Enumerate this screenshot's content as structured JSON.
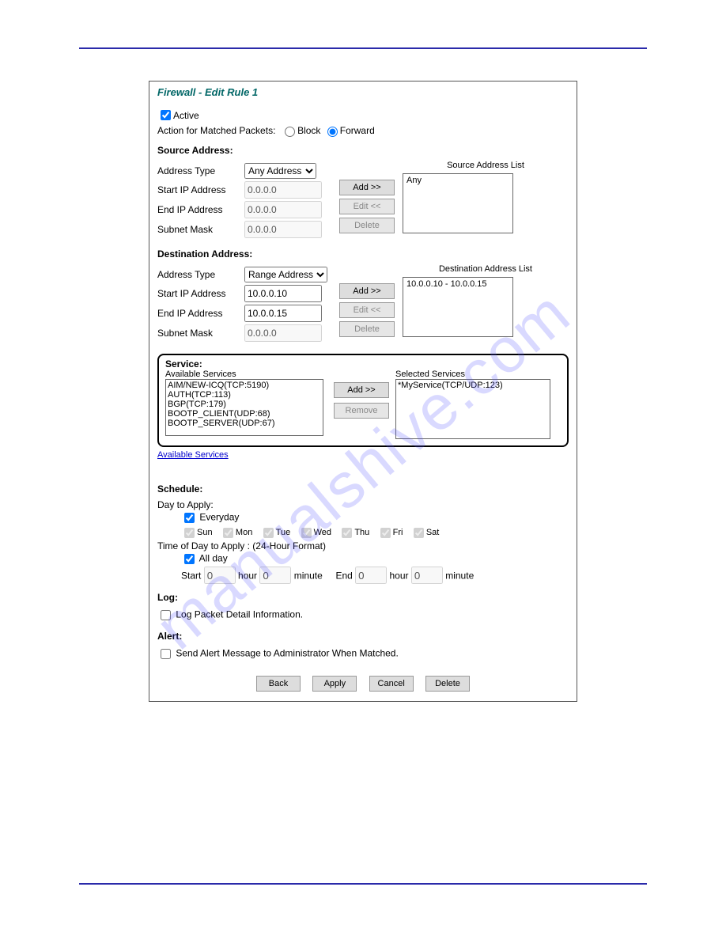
{
  "watermark": "manualshive.com",
  "panel_title": "Firewall - Edit Rule 1",
  "active_label": "Active",
  "active_checked": true,
  "action_label": "Action for Matched Packets:",
  "action_block": "Block",
  "action_forward": "Forward",
  "action_selected": "Forward",
  "source": {
    "heading": "Source Address:",
    "list_label": "Source Address List",
    "address_type_label": "Address Type",
    "address_type_value": "Any Address",
    "start_ip_label": "Start IP Address",
    "start_ip_value": "0.0.0.0",
    "end_ip_label": "End IP Address",
    "end_ip_value": "0.0.0.0",
    "subnet_label": "Subnet Mask",
    "subnet_value": "0.0.0.0",
    "add_btn": "Add >>",
    "edit_btn": "Edit <<",
    "delete_btn": "Delete",
    "list_items": [
      "Any"
    ]
  },
  "dest": {
    "heading": "Destination Address:",
    "list_label": "Destination Address List",
    "address_type_label": "Address Type",
    "address_type_value": "Range Address",
    "start_ip_label": "Start IP Address",
    "start_ip_value": "10.0.0.10",
    "end_ip_label": "End IP Address",
    "end_ip_value": "10.0.0.15",
    "subnet_label": "Subnet Mask",
    "subnet_value": "0.0.0.0",
    "add_btn": "Add >>",
    "edit_btn": "Edit <<",
    "delete_btn": "Delete",
    "list_items": [
      "10.0.0.10 - 10.0.0.15"
    ]
  },
  "service": {
    "heading": "Service:",
    "available_label": "Available Services",
    "selected_label": "Selected Services",
    "add_btn": "Add >>",
    "remove_btn": "Remove",
    "link": "Available Services",
    "available": [
      "AIM/NEW-ICQ(TCP:5190)",
      "AUTH(TCP:113)",
      "BGP(TCP:179)",
      "BOOTP_CLIENT(UDP:68)",
      "BOOTP_SERVER(UDP:67)"
    ],
    "selected": [
      "*MyService(TCP/UDP:123)"
    ]
  },
  "schedule": {
    "heading": "Schedule:",
    "day_to_apply": "Day to Apply:",
    "everyday_label": "Everyday",
    "everyday_checked": true,
    "days": {
      "Sun": true,
      "Mon": true,
      "Tue": true,
      "Wed": true,
      "Thu": true,
      "Fri": true,
      "Sat": true
    },
    "time_label": "Time of Day to Apply : (24-Hour Format)",
    "all_day_label": "All day",
    "all_day_checked": true,
    "start_label": "Start",
    "end_label": "End",
    "hour_label": "hour",
    "minute_label": "minute",
    "start_hour": "0",
    "start_minute": "0",
    "end_hour": "0",
    "end_minute": "0"
  },
  "log": {
    "heading": "Log:",
    "label": "Log Packet Detail Information.",
    "checked": false
  },
  "alert": {
    "heading": "Alert:",
    "label": "Send Alert Message to Administrator When Matched.",
    "checked": false
  },
  "buttons": {
    "back": "Back",
    "apply": "Apply",
    "cancel": "Cancel",
    "delete": "Delete"
  }
}
